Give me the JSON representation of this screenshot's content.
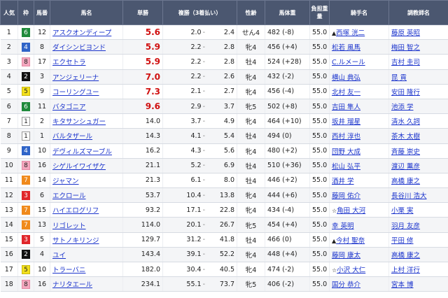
{
  "headers": [
    "人気",
    "枠",
    "馬番",
    "馬名",
    "単勝",
    "複勝（3着払い）",
    "性齢",
    "馬体重",
    "負担重量",
    "騎手名",
    "調教師名"
  ],
  "waku_colors": {
    "1": {
      "bg": "#ffffff",
      "fg": "#222222",
      "border": "#999999"
    },
    "2": {
      "bg": "#111111",
      "fg": "#ffffff",
      "border": "#111111"
    },
    "3": {
      "bg": "#e0262b",
      "fg": "#ffffff",
      "border": "#e0262b"
    },
    "4": {
      "bg": "#2f64c8",
      "fg": "#ffffff",
      "border": "#2f64c8"
    },
    "5": {
      "bg": "#f3e01c",
      "fg": "#222222",
      "border": "#c9b90f"
    },
    "6": {
      "bg": "#1f8a3b",
      "fg": "#ffffff",
      "border": "#1f8a3b"
    },
    "7": {
      "bg": "#f08a1c",
      "fg": "#ffffff",
      "border": "#f08a1c"
    },
    "8": {
      "bg": "#f4a8bf",
      "fg": "#222222",
      "border": "#e58aa5"
    }
  },
  "rows": [
    {
      "rank": "1",
      "waku": "6",
      "num": "12",
      "horse": "アスクオンディープ",
      "win": "5.6",
      "red": true,
      "place_lo": "2.0",
      "place_hi": "2.4",
      "sexage": "せん4",
      "weight": "482 (-8)",
      "load": "55.0",
      "jockey_mark": "▲",
      "jockey": "西塚 洸二",
      "trainer": "藤原 英昭"
    },
    {
      "rank": "2",
      "waku": "4",
      "num": "8",
      "horse": "ダイシンビヨンド",
      "win": "5.9",
      "red": true,
      "place_lo": "2.2",
      "place_hi": "2.8",
      "sexage": "牝4",
      "weight": "456 (+4)",
      "load": "55.0",
      "jockey_mark": "",
      "jockey": "松若 風馬",
      "trainer": "梅田 智之"
    },
    {
      "rank": "3",
      "waku": "8",
      "num": "17",
      "horse": "エクセトラ",
      "win": "5.9",
      "red": true,
      "place_lo": "2.2",
      "place_hi": "2.8",
      "sexage": "牡4",
      "weight": "524 (+28)",
      "load": "55.0",
      "jockey_mark": "",
      "jockey": "C.ルメール",
      "trainer": "吉村 圭司"
    },
    {
      "rank": "4",
      "waku": "2",
      "num": "3",
      "horse": "アンジェリーナ",
      "win": "7.0",
      "red": true,
      "place_lo": "2.2",
      "place_hi": "2.6",
      "sexage": "牝4",
      "weight": "432 (-2)",
      "load": "55.0",
      "jockey_mark": "",
      "jockey": "横山 典弘",
      "trainer": "昆 貢"
    },
    {
      "rank": "5",
      "waku": "5",
      "num": "9",
      "horse": "コーリングユー",
      "win": "7.3",
      "red": true,
      "place_lo": "2.1",
      "place_hi": "2.7",
      "sexage": "牝4",
      "weight": "456 (-4)",
      "load": "55.0",
      "jockey_mark": "",
      "jockey": "北村 友一",
      "trainer": "安田 隆行"
    },
    {
      "rank": "6",
      "waku": "6",
      "num": "11",
      "horse": "バタゴニア",
      "win": "9.6",
      "red": true,
      "place_lo": "2.9",
      "place_hi": "3.7",
      "sexage": "牝5",
      "weight": "502 (+8)",
      "load": "55.0",
      "jockey_mark": "",
      "jockey": "吉田 隼人",
      "trainer": "池添 学"
    },
    {
      "rank": "7",
      "waku": "1",
      "num": "2",
      "horse": "キタサンシュガー",
      "win": "14.0",
      "red": false,
      "place_lo": "3.7",
      "place_hi": "4.9",
      "sexage": "牝4",
      "weight": "464 (+10)",
      "load": "55.0",
      "jockey_mark": "",
      "jockey": "坂井 瑠星",
      "trainer": "清水 久詞"
    },
    {
      "rank": "8",
      "waku": "1",
      "num": "1",
      "horse": "バルタザール",
      "win": "14.3",
      "red": false,
      "place_lo": "4.1",
      "place_hi": "5.4",
      "sexage": "牡4",
      "weight": "494 (0)",
      "load": "55.0",
      "jockey_mark": "",
      "jockey": "西村 淳也",
      "trainer": "茶木 太樹"
    },
    {
      "rank": "9",
      "waku": "4",
      "num": "10",
      "horse": "デヴィルズマーブル",
      "win": "16.2",
      "red": false,
      "place_lo": "4.3",
      "place_hi": "5.6",
      "sexage": "牝4",
      "weight": "480 (+2)",
      "load": "55.0",
      "jockey_mark": "",
      "jockey": "団野 大成",
      "trainer": "斉藤 崇史"
    },
    {
      "rank": "10",
      "waku": "8",
      "num": "16",
      "horse": "シゲルイワイザケ",
      "win": "21.1",
      "red": false,
      "place_lo": "5.2",
      "place_hi": "6.9",
      "sexage": "牡4",
      "weight": "510 (+36)",
      "load": "55.0",
      "jockey_mark": "",
      "jockey": "松山 弘平",
      "trainer": "渡辺 薫彦"
    },
    {
      "rank": "11",
      "waku": "7",
      "num": "14",
      "horse": "ジャマン",
      "win": "21.3",
      "red": false,
      "place_lo": "6.1",
      "place_hi": "8.0",
      "sexage": "牡4",
      "weight": "446 (+2)",
      "load": "55.0",
      "jockey_mark": "",
      "jockey": "酒井 学",
      "trainer": "高橋 康之"
    },
    {
      "rank": "12",
      "waku": "3",
      "num": "6",
      "horse": "エクロール",
      "win": "53.7",
      "red": false,
      "place_lo": "10.4",
      "place_hi": "13.8",
      "sexage": "牝4",
      "weight": "444 (+6)",
      "load": "55.0",
      "jockey_mark": "",
      "jockey": "藤岡 佑介",
      "trainer": "長谷川 浩大"
    },
    {
      "rank": "13",
      "waku": "7",
      "num": "15",
      "horse": "ハイエログリフ",
      "win": "93.2",
      "red": false,
      "place_lo": "17.1",
      "place_hi": "22.8",
      "sexage": "牝4",
      "weight": "434 (-4)",
      "load": "55.0",
      "jockey_mark": "☆",
      "jockey": "角田 大河",
      "trainer": "小栗 実"
    },
    {
      "rank": "14",
      "waku": "7",
      "num": "13",
      "horse": "リゴレット",
      "win": "114.0",
      "red": false,
      "place_lo": "20.1",
      "place_hi": "26.7",
      "sexage": "牝5",
      "weight": "454 (+4)",
      "load": "55.0",
      "jockey_mark": "",
      "jockey": "幸 英明",
      "trainer": "羽月 友彦"
    },
    {
      "rank": "15",
      "waku": "3",
      "num": "5",
      "horse": "サトノキリンジ",
      "win": "129.7",
      "red": false,
      "place_lo": "31.2",
      "place_hi": "41.8",
      "sexage": "牡4",
      "weight": "466 (0)",
      "load": "55.0",
      "jockey_mark": "▲",
      "jockey": "今村 聖奈",
      "trainer": "平田 修"
    },
    {
      "rank": "16",
      "waku": "2",
      "num": "4",
      "horse": "ユイ",
      "win": "143.4",
      "red": false,
      "place_lo": "39.1",
      "place_hi": "52.2",
      "sexage": "牝4",
      "weight": "448 (+4)",
      "load": "55.0",
      "jockey_mark": "",
      "jockey": "藤岡 康太",
      "trainer": "高橋 康之"
    },
    {
      "rank": "17",
      "waku": "5",
      "num": "10",
      "horse": "トラーバニ",
      "win": "182.0",
      "red": false,
      "place_lo": "30.4",
      "place_hi": "40.5",
      "sexage": "牝4",
      "weight": "474 (-2)",
      "load": "55.0",
      "jockey_mark": "☆",
      "jockey": "小沢 大仁",
      "trainer": "上村 洋行"
    },
    {
      "rank": "18",
      "waku": "8",
      "num": "16",
      "horse": "ナリタエール",
      "win": "234.1",
      "red": false,
      "place_lo": "55.1",
      "place_hi": "73.7",
      "sexage": "牝5",
      "weight": "406 (-2)",
      "load": "55.0",
      "jockey_mark": "",
      "jockey": "国分 恭介",
      "trainer": "宮本 博"
    }
  ]
}
